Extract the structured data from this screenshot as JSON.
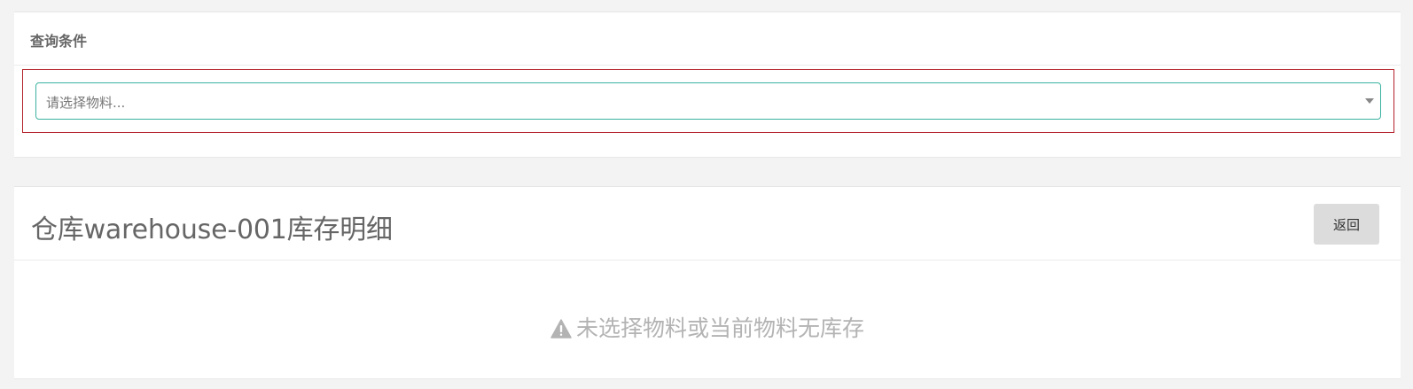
{
  "query": {
    "title": "查询条件",
    "material_select": {
      "placeholder": "请选择物料..."
    }
  },
  "detail": {
    "title": "仓库warehouse-001库存明细",
    "back_label": "返回",
    "empty_message": "未选择物料或当前物料无库存"
  },
  "icons": {
    "select_arrow": "chevron-down-icon",
    "empty_state": "warning-icon"
  },
  "colors": {
    "select_border": "#3bb3a0",
    "highlight_border": "#b5222b",
    "button_background": "#dcdcdc",
    "empty_text": "#b3b3b3"
  }
}
